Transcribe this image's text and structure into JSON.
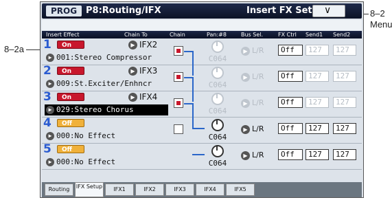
{
  "callouts": {
    "menu": "8–2",
    "menu2": "Menu",
    "slot1": "8–2a"
  },
  "titlebar": {
    "mode": "PROG",
    "title": "P8:Routing/IFX",
    "page": "Insert FX Setup",
    "menu_glyph": "∨"
  },
  "header": {
    "insert_effect": "Insert Effect",
    "chain_to": "Chain To",
    "chain": "Chain",
    "pan": "Pan:#8",
    "bus_sel": "Bus Sel.",
    "fx_ctrl": "FX Ctrl",
    "send1": "Send1",
    "send2": "Send2"
  },
  "slots": [
    {
      "num": "1",
      "state": "On",
      "chain_to": "IFX2",
      "effect": "001:Stereo Compressor",
      "pan": "C064",
      "bus": "L/R",
      "fx_ctrl": "Off",
      "send1": "127",
      "send2": "127"
    },
    {
      "num": "2",
      "state": "On",
      "chain_to": "IFX3",
      "effect": "009:St.Exciter/Enhncr",
      "pan": "C064",
      "bus": "L/R",
      "fx_ctrl": "Off",
      "send1": "127",
      "send2": "127"
    },
    {
      "num": "3",
      "state": "On",
      "chain_to": "IFX4",
      "effect": "029:Stereo Chorus",
      "pan": "C064",
      "bus": "L/R",
      "fx_ctrl": "Off",
      "send1": "127",
      "send2": "127"
    },
    {
      "num": "4",
      "state": "Off",
      "chain_to": "",
      "effect": "000:No Effect",
      "pan": "C064",
      "bus": "L/R",
      "fx_ctrl": "Off",
      "send1": "127",
      "send2": "127"
    },
    {
      "num": "5",
      "state": "Off",
      "chain_to": "",
      "effect": "000:No Effect",
      "pan": "C064",
      "bus": "L/R",
      "fx_ctrl": "Off",
      "send1": "127",
      "send2": "127"
    }
  ],
  "tabs": [
    "Routing",
    "IFX Setup",
    "IFX1",
    "IFX2",
    "IFX3",
    "IFX4",
    "IFX5"
  ],
  "active_tab": "IFX Setup",
  "colors": {
    "on": "#c8172c",
    "off": "#f0b13a",
    "slot_num": "#2a5bd0",
    "title_bg": "#0b1226"
  }
}
